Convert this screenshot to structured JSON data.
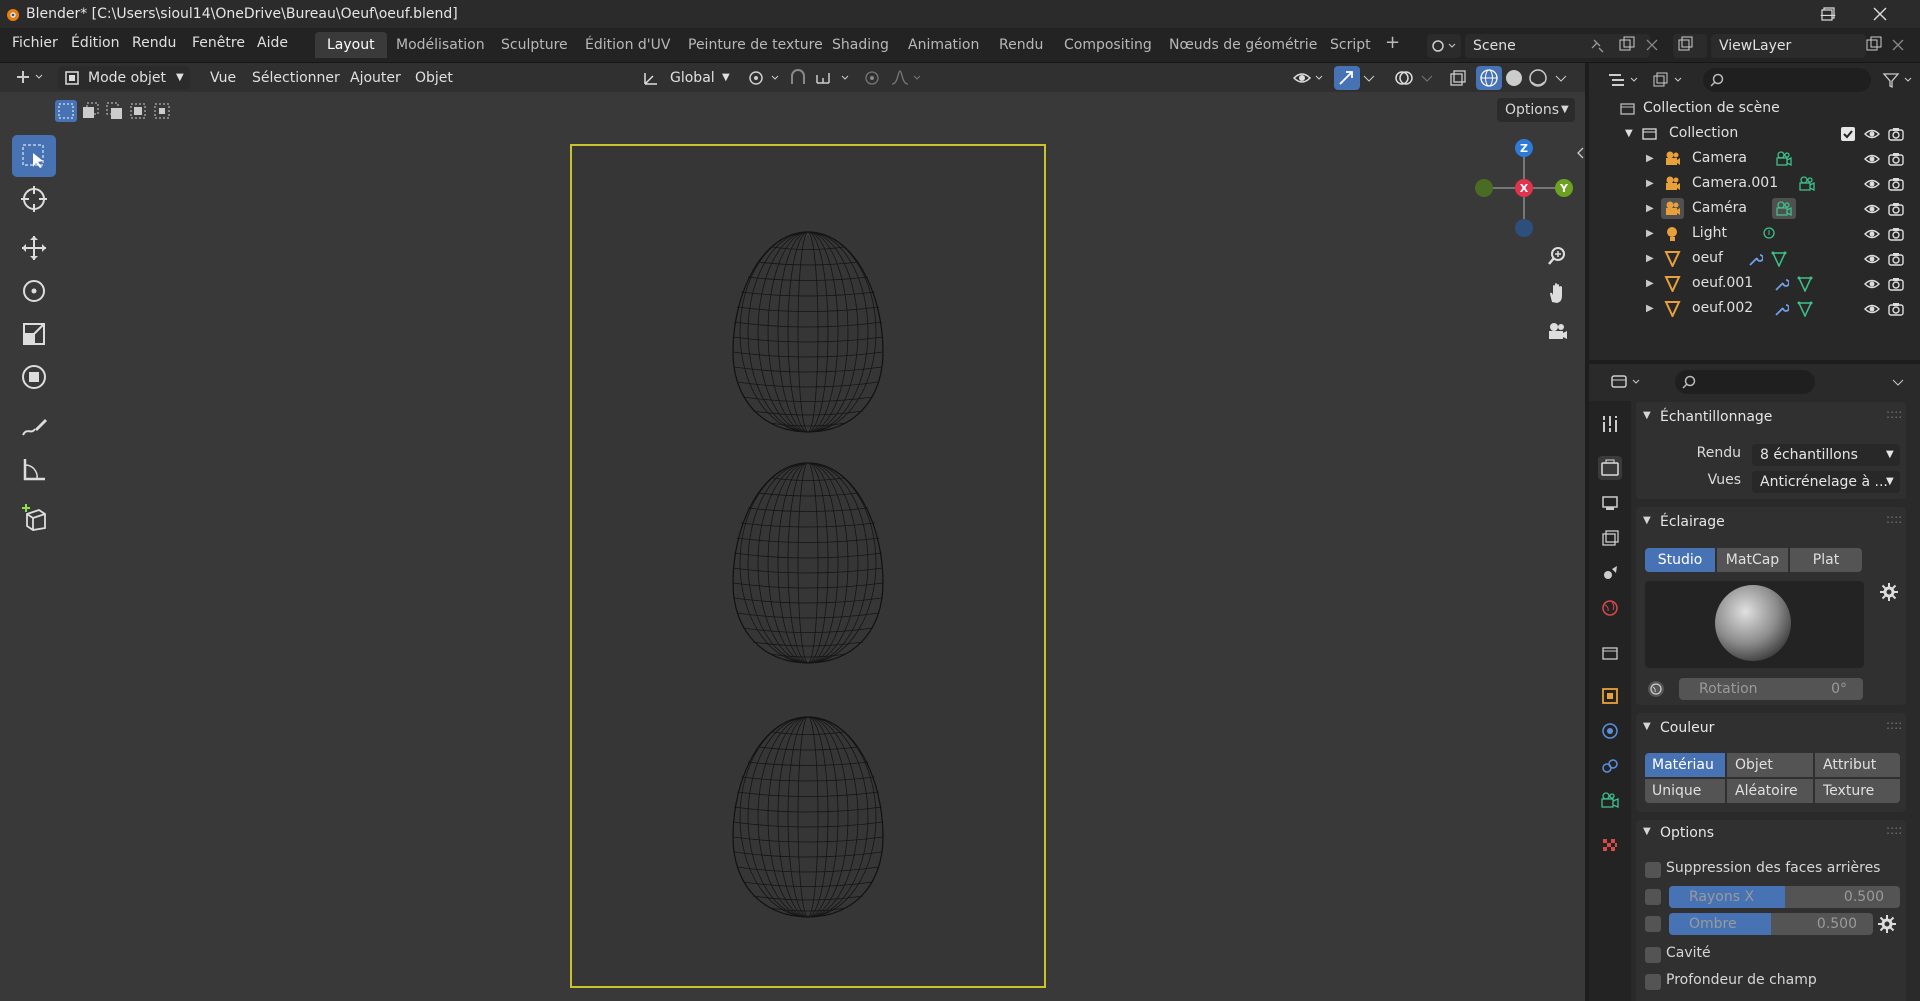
{
  "window": {
    "title": "Blender* [C:\\Users\\sioul14\\OneDrive\\Bureau\\Oeuf\\oeuf.blend]"
  },
  "menu": [
    "Fichier",
    "Édition",
    "Rendu",
    "Fenêtre",
    "Aide"
  ],
  "workspaces": [
    "Layout",
    "Modélisation",
    "Sculpture",
    "Édition d'UV",
    "Peinture de texture",
    "Shading",
    "Animation",
    "Rendu",
    "Compositing",
    "Nœuds de géométrie",
    "Script"
  ],
  "scene": {
    "name": "Scene",
    "view_layer": "ViewLayer"
  },
  "viewport_header": {
    "mode": "Mode objet",
    "menus": [
      "Vue",
      "Sélectionner",
      "Ajouter",
      "Objet"
    ],
    "orientation": "Global",
    "options": "Options"
  },
  "gizmo": {
    "z": "Z",
    "x": "X",
    "y": "Y"
  },
  "outliner": {
    "root": "Collection de scène",
    "collection": "Collection",
    "items": [
      "Camera",
      "Camera.001",
      "Caméra",
      "Light",
      "oeuf",
      "oeuf.001",
      "oeuf.002"
    ]
  },
  "properties": {
    "sampling": {
      "title": "Échantillonnage",
      "render_label": "Rendu",
      "render_value": "8 échantillons",
      "views_label": "Vues",
      "views_value": "Anticrénelage à ..."
    },
    "lighting": {
      "title": "Éclairage",
      "modes": [
        "Studio",
        "MatCap",
        "Plat"
      ],
      "rotation_label": "Rotation",
      "rotation_value": "0°"
    },
    "color": {
      "title": "Couleur",
      "options": [
        "Matériau",
        "Objet",
        "Attribut",
        "Unique",
        "Aléatoire",
        "Texture"
      ]
    },
    "options": {
      "title": "Options",
      "backface": "Suppression des faces arrières",
      "xray_label": "Rayons X",
      "xray_value": "0.500",
      "xray_fill": 0.5,
      "shadow_label": "Ombre",
      "shadow_value": "0.500",
      "shadow_fill": 0.5,
      "cavity": "Cavité",
      "dof": "Profondeur de champ"
    }
  },
  "colors": {
    "accent": "#4772b3",
    "camera_frame": "#c9c32e"
  }
}
